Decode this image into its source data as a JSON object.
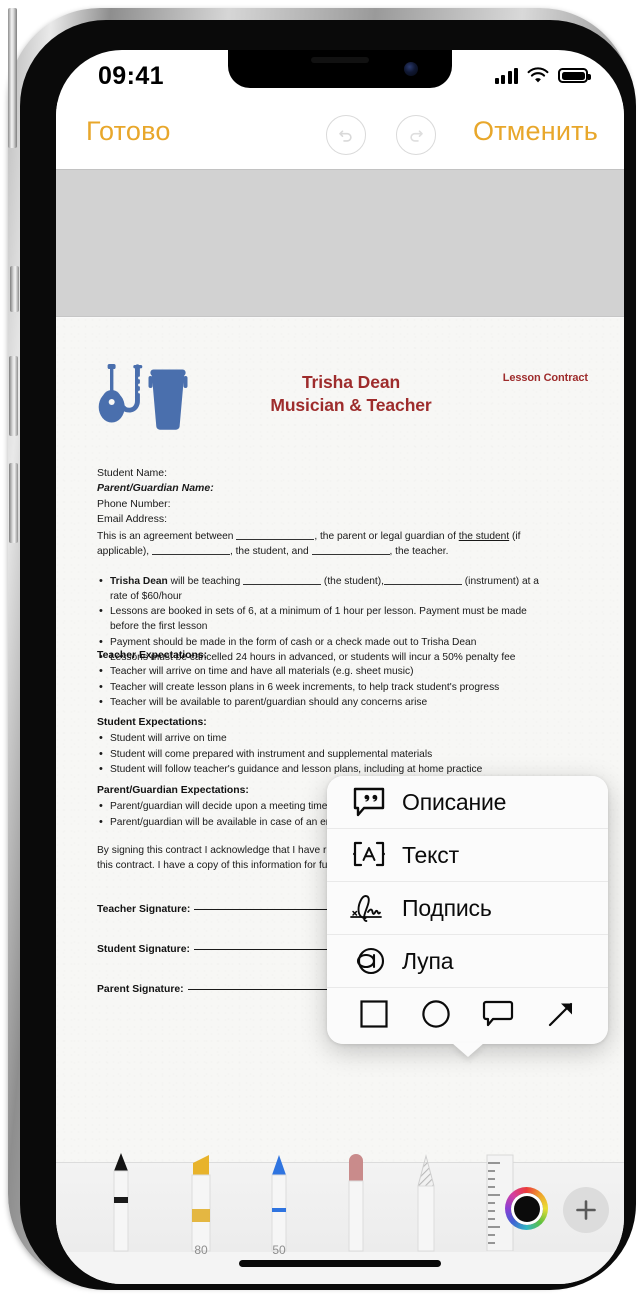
{
  "status_bar": {
    "time": "09:41",
    "signal_icon": "cellular-signal-icon",
    "wifi_icon": "wifi-icon",
    "battery_icon": "battery-full-icon"
  },
  "nav_bar": {
    "done_label": "Готово",
    "cancel_label": "Отменить",
    "undo_icon": "undo-arrow-icon",
    "redo_icon": "redo-arrow-icon",
    "accent_color": "#e8a72b"
  },
  "document": {
    "logo_icon": "musical-instruments-icon",
    "title_line1": "Trisha Dean",
    "title_line2": "Musician & Teacher",
    "kicker": "Lesson Contract",
    "title_color": "#9e2c2c",
    "fields": [
      "Student Name:",
      "Parent/Guardian Name:",
      "Phone Number:",
      "Email Address:"
    ],
    "intro_paragraph": "This is an agreement between ____________, the parent or legal guardian of the student (if applicable), ____________, the student, and ____________, the teacher.",
    "terms": [
      "Trisha Dean will be teaching ____________ (the student),____________ (instrument) at a rate of $60/hour",
      "Lessons are booked in sets of 6, at a minimum of 1 hour per lesson. Payment must be made before the first lesson",
      "Payment should be made in the form of cash or a check made out to Trisha Dean",
      "Lessons must be cancelled 24 hours in advanced, or students will incur a 50% penalty fee"
    ],
    "teacher_heading": "Teacher Expectations:",
    "teacher_items": [
      "Teacher will arrive on time and have all materials (e.g. sheet music)",
      "Teacher will create lesson plans in 6 week increments, to help track student's progress",
      "Teacher will be available to parent/guardian should any concerns arise"
    ],
    "student_heading": "Student Expectations:",
    "student_items": [
      "Student will arrive on time",
      "Student will come prepared with instrument and supplemental materials",
      "Student will follow teacher's guidance and lesson plans, including at home practice"
    ],
    "parent_heading": "Parent/Guardian Expectations:",
    "parent_items": [
      "Parent/guardian will decide upon a meeting time and place that works for all parties",
      "Parent/guardian will be available in case of an emergency, or should any concerns come up"
    ],
    "signing_paragraph_line1": "By signing this contract I acknowledge that I have r",
    "signing_paragraph_line2": "this contract. I have a copy of this information for fu",
    "signature_lines": [
      "Teacher Signature:",
      "Student Signature:",
      "Parent Signature:"
    ]
  },
  "popup_menu": {
    "items": [
      {
        "label": "Описание",
        "icon": "quote-bubble-icon"
      },
      {
        "label": "Текст",
        "icon": "text-box-icon"
      },
      {
        "label": "Подпись",
        "icon": "signature-icon"
      },
      {
        "label": "Лупа",
        "icon": "magnifier-icon"
      }
    ],
    "shapes": [
      {
        "icon": "square-shape-icon"
      },
      {
        "icon": "circle-shape-icon"
      },
      {
        "icon": "speech-bubble-shape-icon"
      },
      {
        "icon": "arrow-shape-icon"
      }
    ]
  },
  "toolbar": {
    "tools": [
      {
        "name": "pen-tool",
        "opacity": ""
      },
      {
        "name": "highlighter-tool",
        "opacity": "80"
      },
      {
        "name": "pencil-tool",
        "opacity": "50"
      },
      {
        "name": "eraser-tool",
        "opacity": ""
      },
      {
        "name": "smudge-tool",
        "opacity": ""
      },
      {
        "name": "ruler-tool",
        "opacity": ""
      }
    ],
    "color_swatch": "#0b0b0b",
    "color_picker_icon": "color-wheel-icon",
    "add_button_icon": "plus-icon"
  }
}
